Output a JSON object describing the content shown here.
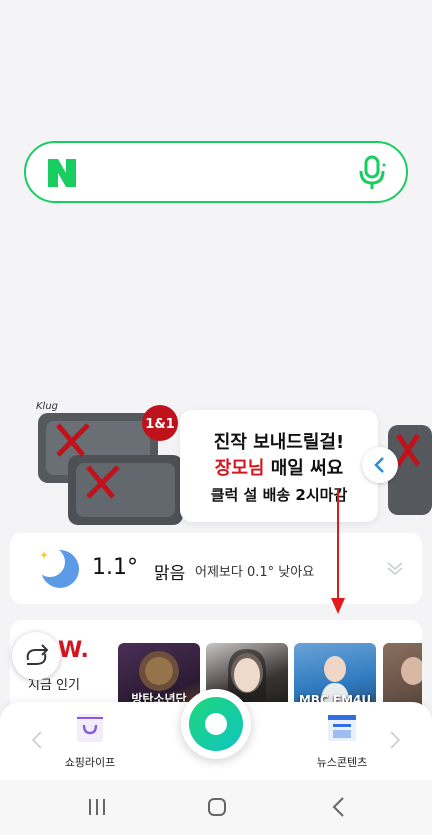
{
  "search": {
    "logo_letter": "N",
    "icons": [
      "naver-n-logo",
      "mic-icon"
    ]
  },
  "ad": {
    "brand": "Klug",
    "badge": "1&1",
    "line1": "진작 보내드릴걸!",
    "line2_highlight": "장모님",
    "line2_rest": " 매일 써요",
    "line3": "클럭 설 배송 2시마감"
  },
  "weather": {
    "temperature": "1.1°",
    "condition": "맑음",
    "comparison": "어제보다 0.1° 낮아요",
    "icon": "moon-icon"
  },
  "trending": {
    "logo": "W.",
    "label": "지금 인기",
    "thumbnails": [
      {
        "caption": "방탄소년단"
      },
      {
        "caption": ""
      },
      {
        "caption": "MBC FM4U"
      },
      {
        "caption": ""
      }
    ]
  },
  "bottom_nav": {
    "shopping_label": "쇼핑라이프",
    "news_label": "뉴스콘텐츠"
  },
  "colors": {
    "naver_green": "#19ce60",
    "accent_red": "#d4151e"
  }
}
